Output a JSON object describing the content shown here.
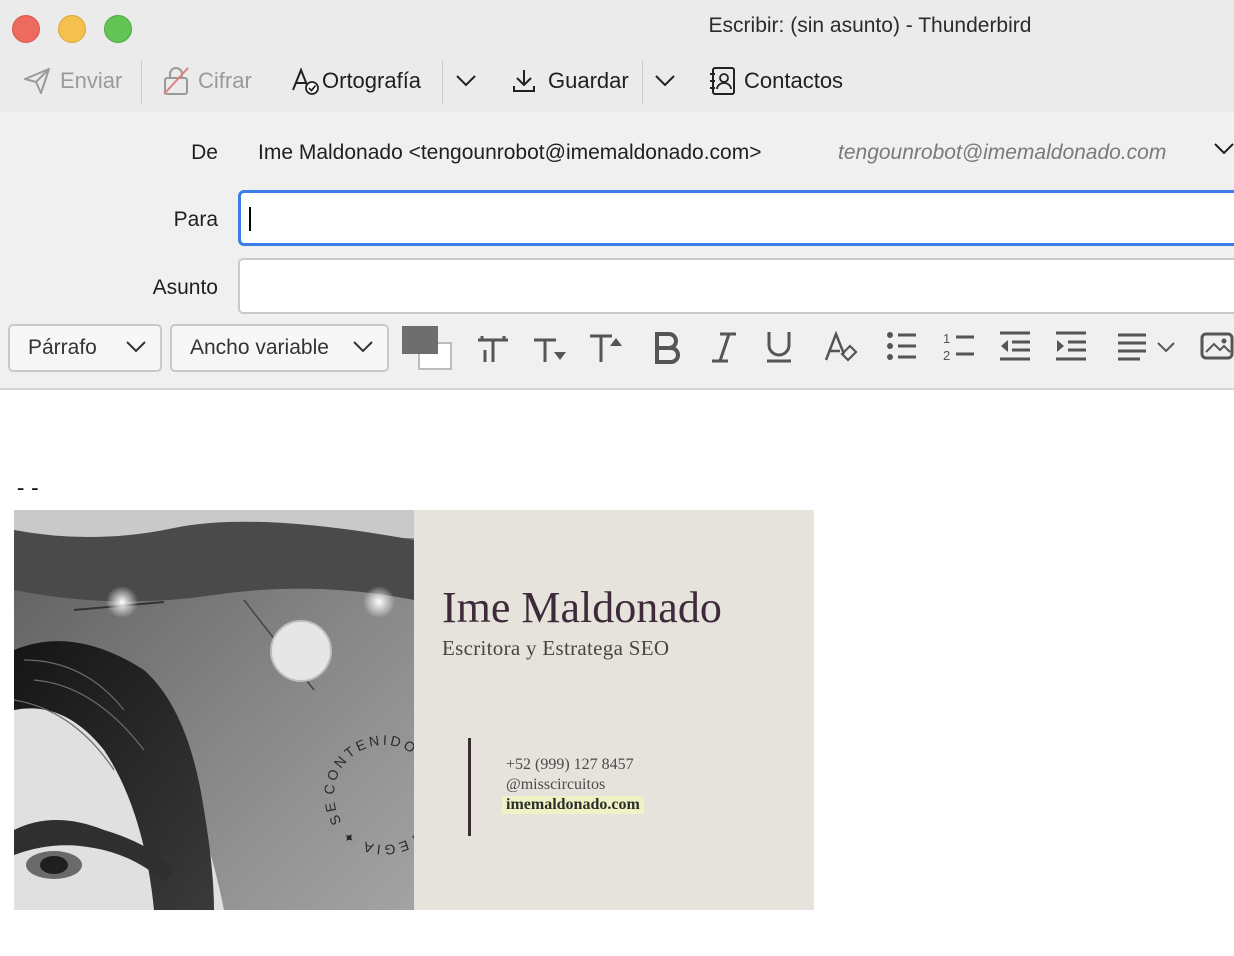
{
  "window": {
    "title": "Escribir: (sin asunto) - Thunderbird"
  },
  "toolbar": {
    "send_label": "Enviar",
    "encrypt_label": "Cifrar",
    "spelling_label": "Ortografía",
    "save_label": "Guardar",
    "contacts_label": "Contactos"
  },
  "headers": {
    "from_label": "De",
    "from_value": "Ime Maldonado <tengounrobot@imemaldonado.com>",
    "from_identity": "tengounrobot@imemaldonado.com",
    "to_label": "Para",
    "to_value": "",
    "subject_label": "Asunto",
    "subject_value": ""
  },
  "format": {
    "paragraph_select": "Párrafo",
    "font_select": "Ancho variable",
    "text_color": "#6e6e6e",
    "background_color": "#ffffff"
  },
  "body": {
    "signature_separator": "--"
  },
  "signature_card": {
    "name": "Ime Maldonado",
    "role": "Escritora y Estratega SEO",
    "phone": "+52 (999) 127 8457",
    "handle": "@misscircuitos",
    "website": "imemaldonado.com",
    "stamp_text": "CONTENIDO ✦ ESTRATEGIA ✦ SEO ✦"
  },
  "colors": {
    "focus_accent": "#3a7ee6",
    "close": "#ed6a5e",
    "minimize": "#f5c04f",
    "maximize": "#61c454"
  }
}
